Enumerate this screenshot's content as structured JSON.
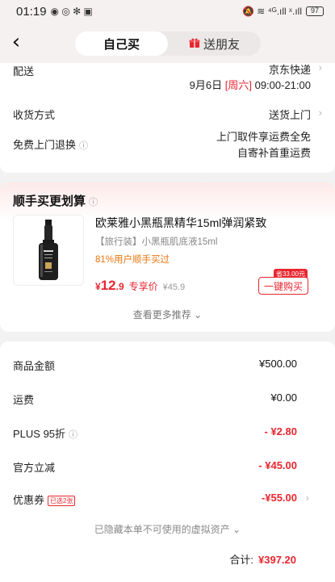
{
  "status_bar": {
    "time": "01:19",
    "left_icons": "◉ ◎ ✻ ▣",
    "right_icons": "🔕 ≋ ⁴ᴳ.ıll ˣ.ıll",
    "battery": "97"
  },
  "nav": {
    "back": "‹",
    "tab_self": "自己买",
    "tab_gift": "送朋友"
  },
  "delivery": {
    "label": "配送",
    "carrier": "京东快递",
    "date": "9月6日",
    "weekday": "[周六]",
    "time_range": "09:00-21:00"
  },
  "receive": {
    "label": "收货方式",
    "value": "送货上门"
  },
  "returns": {
    "label": "免费上门退换",
    "line1": "上门取件享运费全免",
    "line2": "自寄补首重运费"
  },
  "recommend": {
    "title": "顺手买更划算",
    "product_name": "欧莱雅小黑瓶黑精华15ml弹润紧致",
    "product_sub": "【旅行装】小黑瓶肌底液15ml",
    "hint": "81%用户顺手买过",
    "currency": "¥",
    "price_int": "12",
    "price_dec": ".9",
    "price_label": "专享价",
    "old_price": "¥45.9",
    "save_badge": "省33.00元",
    "buy_label": "一键购买",
    "more": "查看更多推荐 ⌄"
  },
  "summary": {
    "goods_label": "商品金额",
    "goods_value": "¥500.00",
    "shipping_label": "运费",
    "shipping_value": "¥0.00",
    "plus_label": "PLUS 95折",
    "plus_value": "- ¥2.80",
    "official_label": "官方立减",
    "official_value": "- ¥45.00",
    "coupon_label": "优惠券",
    "coupon_badge": "已选2张",
    "coupon_value": "-¥55.00",
    "hidden_note": "已隐藏本单不可使用的虚拟资产 ⌄",
    "total_label": "合计:",
    "total_value": "¥397.20"
  },
  "colors": {
    "accent": "#e8262f",
    "orange": "#e8750c"
  }
}
